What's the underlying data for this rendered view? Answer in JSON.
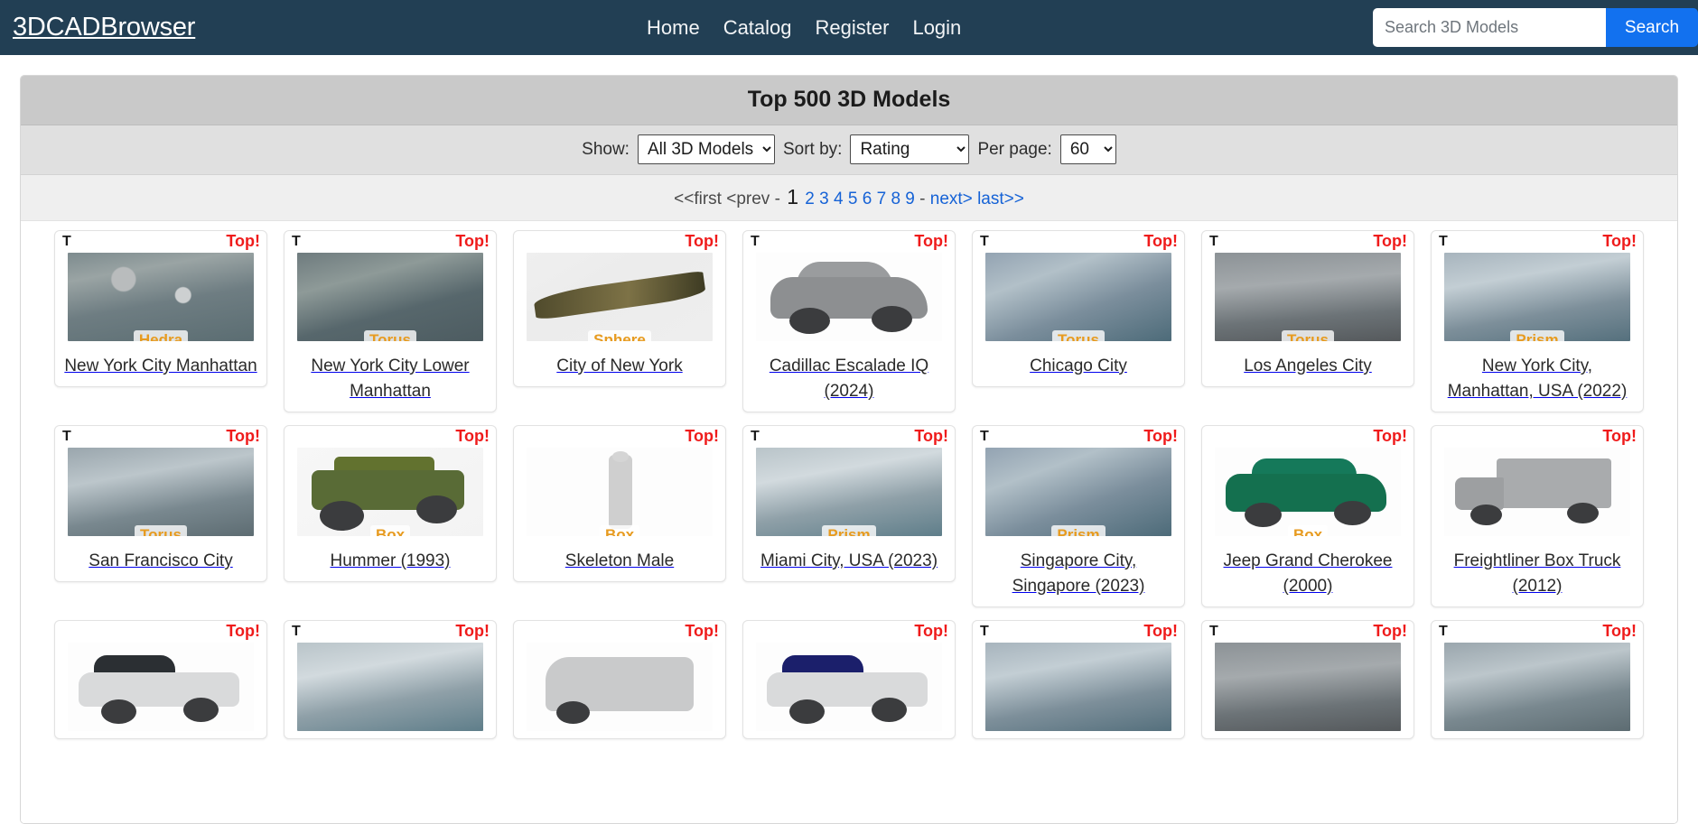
{
  "navbar": {
    "brand": "3DCADBrowser",
    "links": [
      {
        "label": "Home"
      },
      {
        "label": "Catalog"
      },
      {
        "label": "Register"
      },
      {
        "label": "Login"
      }
    ],
    "search": {
      "placeholder": "Search 3D Models",
      "value": "",
      "button_label": "Search"
    },
    "background_color": "#223f54",
    "button_color": "#1271ef"
  },
  "panel": {
    "title": "Top 500 3D Models",
    "controls": {
      "show_label": "Show:",
      "show_value": "All 3D Models",
      "show_options": [
        "All 3D Models"
      ],
      "sort_label": "Sort by:",
      "sort_value": "Rating",
      "sort_options": [
        "Rating"
      ],
      "per_page_label": "Per page:",
      "per_page_value": "60",
      "per_page_options": [
        "60"
      ]
    },
    "pagination": {
      "first": "<<first",
      "prev": "<prev",
      "dash_left": "-",
      "current": "1",
      "pages": [
        "2",
        "3",
        "4",
        "5",
        "6",
        "7",
        "8",
        "9"
      ],
      "dash_right": "-",
      "next": "next>",
      "last": "last>>"
    }
  },
  "badges": {
    "t": "T",
    "top": "Top!"
  },
  "rows": [
    {
      "cards": [
        {
          "has_t": true,
          "has_top": true,
          "tag": "Hedra",
          "title": "New York City Manhattan",
          "art": "art-city-a",
          "obj": "none"
        },
        {
          "has_t": true,
          "has_top": true,
          "tag": "Torus",
          "title": "New York City Lower Manhattan",
          "art": "art-city-b",
          "obj": "none"
        },
        {
          "has_t": false,
          "has_top": true,
          "tag": "Sphere",
          "title": "City of New York",
          "art": "art-veg",
          "obj": "island"
        },
        {
          "has_t": true,
          "has_top": true,
          "tag": "",
          "title": "Cadillac Escalade IQ (2024)",
          "art": "art-white",
          "obj": "suv"
        },
        {
          "has_t": true,
          "has_top": true,
          "tag": "Torus",
          "title": "Chicago City",
          "art": "art-city-c",
          "obj": "none"
        },
        {
          "has_t": true,
          "has_top": true,
          "tag": "Torus",
          "title": "Los Angeles City",
          "art": "art-city-d",
          "obj": "none"
        },
        {
          "has_t": true,
          "has_top": true,
          "tag": "Prism",
          "title": "New York City, Manhattan, USA (2022)",
          "art": "art-city-e",
          "obj": "none"
        }
      ]
    },
    {
      "cards": [
        {
          "has_t": true,
          "has_top": true,
          "tag": "Torus",
          "title": "San Francisco City",
          "art": "art-city-f",
          "obj": "none"
        },
        {
          "has_t": false,
          "has_top": true,
          "tag": "Box",
          "title": "Hummer (1993)",
          "art": "art-green",
          "obj": "hummer"
        },
        {
          "has_t": false,
          "has_top": true,
          "tag": "Box",
          "title": "Skeleton Male",
          "art": "art-white",
          "obj": "skeleton"
        },
        {
          "has_t": true,
          "has_top": true,
          "tag": "Prism",
          "title": "Miami City, USA (2023)",
          "art": "art-city-g",
          "obj": "none"
        },
        {
          "has_t": true,
          "has_top": true,
          "tag": "Prism",
          "title": "Singapore City, Singapore (2023)",
          "art": "art-city-c",
          "obj": "none"
        },
        {
          "has_t": false,
          "has_top": true,
          "tag": "Box",
          "title": "Jeep Grand Cherokee (2000)",
          "art": "art-white",
          "obj": "jeep"
        },
        {
          "has_t": false,
          "has_top": true,
          "tag": "",
          "title": "Freightliner Box Truck (2012)",
          "art": "art-white",
          "obj": "truck"
        }
      ]
    },
    {
      "cards": [
        {
          "has_t": false,
          "has_top": true,
          "tag": "",
          "title": "",
          "art": "art-white",
          "obj": "pickup"
        },
        {
          "has_t": true,
          "has_top": true,
          "tag": "",
          "title": "",
          "art": "art-city-g",
          "obj": "none"
        },
        {
          "has_t": false,
          "has_top": true,
          "tag": "",
          "title": "",
          "art": "art-white",
          "obj": "van"
        },
        {
          "has_t": false,
          "has_top": true,
          "tag": "",
          "title": "",
          "art": "art-white",
          "obj": "pickup-blue"
        },
        {
          "has_t": true,
          "has_top": true,
          "tag": "",
          "title": "",
          "art": "art-city-e",
          "obj": "none"
        },
        {
          "has_t": true,
          "has_top": true,
          "tag": "",
          "title": "",
          "art": "art-city-d",
          "obj": "none"
        },
        {
          "has_t": true,
          "has_top": true,
          "tag": "",
          "title": "",
          "art": "art-city-f",
          "obj": "none"
        }
      ]
    }
  ]
}
